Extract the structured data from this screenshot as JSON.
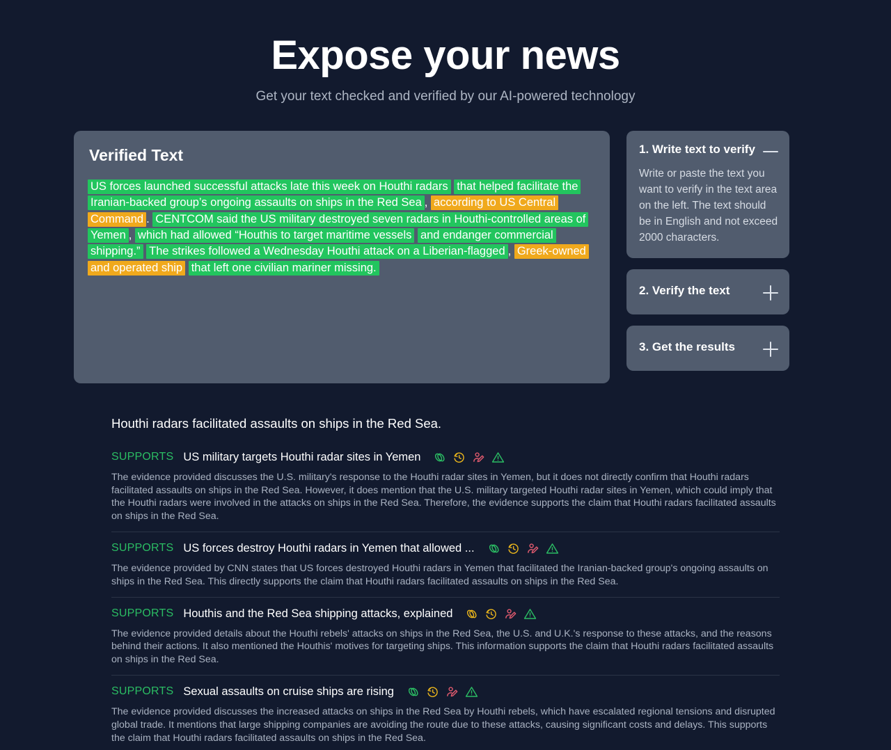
{
  "header": {
    "title": "Expose your news",
    "subtitle": "Get your text checked and verified by our AI-powered technology"
  },
  "colors": {
    "page_background": "#121a2e",
    "card_background": "#515c6e",
    "supports_green": "#2bbd63",
    "highlight_supports": "#22c55e",
    "highlight_warning": "#f0a91c",
    "icon_link_green": "#2bbd63",
    "icon_link_yellow": "#e7b31c",
    "icon_history_yellow": "#e7b31c",
    "icon_person_red": "#e05a6e",
    "icon_warning_green": "#2bbd63"
  },
  "verified_panel": {
    "title": "Verified Text",
    "segments": [
      {
        "text": "US forces launched successful attacks late this week on Houthi radars",
        "highlight": "supports"
      },
      {
        "text": " ",
        "highlight": "none"
      },
      {
        "text": "that helped facilitate the Iranian-backed group’s ongoing assaults on ships in the Red Sea",
        "highlight": "supports"
      },
      {
        "text": ", ",
        "highlight": "none"
      },
      {
        "text": "according to US Central Command",
        "highlight": "warning"
      },
      {
        "text": ". ",
        "highlight": "none"
      },
      {
        "text": "CENTCOM said the US military destroyed seven radars  in Houthi-controlled areas of Yemen",
        "highlight": "supports"
      },
      {
        "text": ", ",
        "highlight": "none"
      },
      {
        "text": "which had allowed “Houthis to target maritime vessels",
        "highlight": "supports"
      },
      {
        "text": " ",
        "highlight": "none"
      },
      {
        "text": "and endanger commercial shipping.”",
        "highlight": "supports"
      },
      {
        "text": " ",
        "highlight": "none"
      },
      {
        "text": "The strikes followed a Wednesday Houthi attack on a Liberian-flagged",
        "highlight": "supports"
      },
      {
        "text": ", ",
        "highlight": "none"
      },
      {
        "text": "Greek-owned and operated ship",
        "highlight": "warning"
      },
      {
        "text": " ",
        "highlight": "none"
      },
      {
        "text": "that left one civilian mariner missing.",
        "highlight": "supports"
      }
    ]
  },
  "steps": [
    {
      "title": "1. Write text to verify",
      "toggle_icon": "minus-icon",
      "expanded": true,
      "body": "Write or paste the text you want to verify in the text area on the left. The text should be in English and not exceed 2000 characters."
    },
    {
      "title": "2. Verify the text",
      "toggle_icon": "plus-icon",
      "expanded": false,
      "body": ""
    },
    {
      "title": "3. Get the results",
      "toggle_icon": "plus-icon",
      "expanded": false,
      "body": ""
    }
  ],
  "results": {
    "claim": "Houthi radars facilitated assaults on ships in the Red Sea.",
    "icon_labels": [
      "link-icon",
      "history-icon",
      "person-edit-icon",
      "warning-triangle-icon"
    ],
    "rows": [
      {
        "verdict": "SUPPORTS",
        "title": "US military targets Houthi radar sites in Yemen",
        "link_color": "green",
        "body": "The evidence provided discusses the U.S. military's response to the Houthi radar sites in Yemen, but it does not directly confirm that Houthi radars facilitated assaults on ships in the Red Sea. However, it does mention that the U.S. military targeted Houthi radar sites in Yemen, which could imply that the Houthi radars were involved in the attacks on ships in the Red Sea. Therefore, the evidence supports the claim that Houthi radars facilitated assaults on ships in the Red Sea."
      },
      {
        "verdict": "SUPPORTS",
        "title": "US forces destroy Houthi radars in Yemen that allowed ...",
        "link_color": "green",
        "body": "The evidence provided by CNN states that US forces destroyed Houthi radars in Yemen that facilitated the Iranian-backed group's ongoing assaults on ships in the Red Sea. This directly supports the claim that Houthi radars facilitated assaults on ships in the Red Sea."
      },
      {
        "verdict": "SUPPORTS",
        "title": "Houthis and the Red Sea shipping attacks, explained",
        "link_color": "yellow",
        "body": "The evidence provided details about the Houthi rebels' attacks on ships in the Red Sea, the U.S. and U.K.'s response to these attacks, and the reasons behind their actions. It also mentioned the Houthis' motives for targeting ships. This information supports the claim that Houthi radars facilitated assaults on ships in the Red Sea."
      },
      {
        "verdict": "SUPPORTS",
        "title": "Sexual assaults on cruise ships are rising",
        "link_color": "green",
        "body": "The evidence provided discusses the increased attacks on ships in the Red Sea by Houthi rebels, which have escalated regional tensions and disrupted global trade. It mentions that large shipping companies are avoiding the route due to these attacks, causing significant costs and delays. This supports the claim that Houthi radars facilitated assaults on ships in the Red Sea."
      }
    ]
  }
}
